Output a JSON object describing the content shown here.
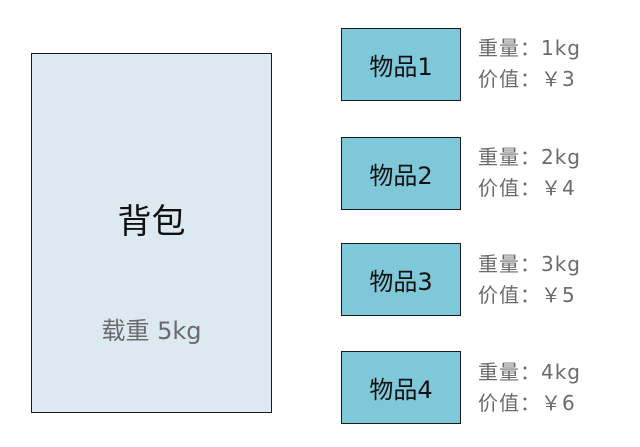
{
  "backpack": {
    "title": "背包",
    "capacity": "载重 5kg"
  },
  "colors": {
    "backpack_fill": "#dde9f0",
    "item_fill": "#7ec8d9",
    "border": "#1a1a1a",
    "secondary_text": "#6b6b6b"
  },
  "items": [
    {
      "name": "物品1",
      "weight": "重量：1kg",
      "value": "价值：￥3"
    },
    {
      "name": "物品2",
      "weight": "重量：2kg",
      "value": "价值：￥4"
    },
    {
      "name": "物品3",
      "weight": "重量：3kg",
      "value": "价值：￥5"
    },
    {
      "name": "物品4",
      "weight": "重量：4kg",
      "value": "价值：￥6"
    }
  ]
}
